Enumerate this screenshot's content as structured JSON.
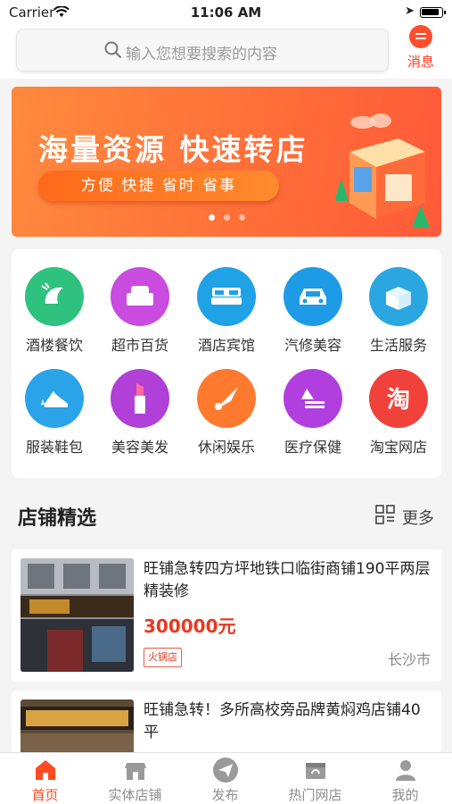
{
  "status_bar": {
    "carrier": "Carrier",
    "time": "11:06 AM"
  },
  "header": {
    "search_placeholder": "输入您想要搜索的内容",
    "message_label": "消息"
  },
  "banner": {
    "title": "海量资源 快速转店",
    "subtitle": "方便 快捷 省时 省事",
    "dots": 3,
    "active_dot": 0
  },
  "categories": [
    {
      "label": "酒楼餐饮",
      "icon": "shrimp-icon",
      "color": "#2ec27e"
    },
    {
      "label": "超市百货",
      "icon": "sofa-icon",
      "color": "#c94be0"
    },
    {
      "label": "酒店宾馆",
      "icon": "bed-icon",
      "color": "#1fa3e6"
    },
    {
      "label": "汽修美容",
      "icon": "car-icon",
      "color": "#1e9be6"
    },
    {
      "label": "生活服务",
      "icon": "box-icon",
      "color": "#2aa7e0"
    },
    {
      "label": "服装鞋包",
      "icon": "high-heel-icon",
      "color": "#2aa3e8"
    },
    {
      "label": "美容美发",
      "icon": "lipstick-icon",
      "color": "#b040d8"
    },
    {
      "label": "休闲娱乐",
      "icon": "shuttlecock-icon",
      "color": "#ff7a2e"
    },
    {
      "label": "医疗保健",
      "icon": "medical-icon",
      "color": "#b13fe0"
    },
    {
      "label": "淘宝网店",
      "icon": "taobao-icon",
      "color": "#f0423a"
    }
  ],
  "section": {
    "title": "店铺精选",
    "more_label": "更多"
  },
  "listings": [
    {
      "title": "旺铺急转四方坪地铁口临街商铺190平两层精装修",
      "price": "300000元",
      "tag": "火锅店",
      "city": "长沙市"
    },
    {
      "title": "旺铺急转！多所高校旁品牌黄焖鸡店铺40平",
      "price": "",
      "tag": "",
      "city": ""
    }
  ],
  "tabs": [
    {
      "label": "首页",
      "icon": "home-icon",
      "active": true
    },
    {
      "label": "实体店铺",
      "icon": "store-icon",
      "active": false
    },
    {
      "label": "发布",
      "icon": "send-icon",
      "active": false
    },
    {
      "label": "热门网店",
      "icon": "online-shop-icon",
      "active": false
    },
    {
      "label": "我的",
      "icon": "user-icon",
      "active": false
    }
  ],
  "colors": {
    "accent": "#ff4b1f",
    "price": "#e8381f",
    "banner": "#ff6d38"
  }
}
